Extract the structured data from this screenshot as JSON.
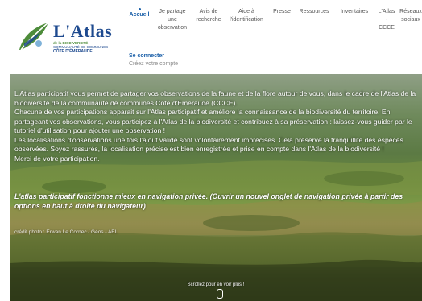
{
  "logo": {
    "title": "L'Atlas",
    "line1": "de la BIODIVERSITÉ",
    "line2": "COMMUNAUTÉ DE COMMUNES",
    "line3": "CÔTE D'ÉMERAUDE"
  },
  "nav": {
    "items": [
      {
        "label": "Accueil",
        "active": true
      },
      {
        "label": "Je partage une observation"
      },
      {
        "label": "Avis de recherche"
      },
      {
        "label": "Aide à l'identification"
      },
      {
        "label": "Presse"
      },
      {
        "label": "Ressources"
      },
      {
        "label": "Inventaires"
      },
      {
        "label": "L'Atlas - CCCE"
      },
      {
        "label": "Réseaux sociaux"
      }
    ]
  },
  "account": {
    "login": "Se connecter",
    "create": "Créez votre compte"
  },
  "hero": {
    "paragraphs": [
      "L'Atlas participatif vous permet de partager vos observations de la faune et de la flore autour de vous, dans le cadre de l'Atlas de la biodiversité de la communauté de communes Côte d'Emeraude (CCCE).",
      "Chacune de vos participations apparait sur l'Atlas participatif et améliore la connaissance de la biodiversité du territoire. En partageant vos observations, vous participez à l'Atlas de la biodiversité et contribuez à sa préservation : laissez-vous guider par le tutoriel d'utilisation pour ajouter une observation !",
      "Les localisations d'observations une fois l'ajout validé sont volontairement imprécises. Cela préserve la tranquillité des espèces observées. Soyez rassurés, la localisation précise est bien enregistrée et prise en compte dans l'Atlas de la biodiversité !",
      "Merci de votre participation."
    ],
    "notice": "L'atlas participatif fonctionne mieux en navigation privée. (Ouvrir un nouvel onglet de navigation privée à partir des options en haut à droite du navigateur)",
    "credit": "crédit photo : Erwan Le Cornec / Géos - AEL",
    "scroll": "Scrollez pour en voir plus !"
  },
  "colors": {
    "brand_blue": "#1a5fa8",
    "logo_green": "#4d8c3a"
  }
}
